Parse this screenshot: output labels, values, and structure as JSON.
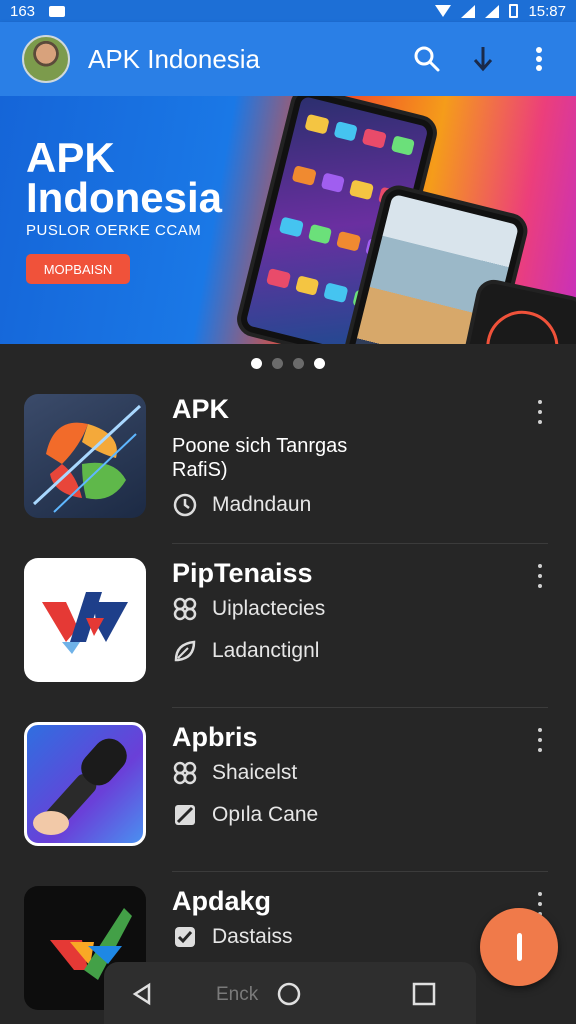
{
  "status_bar": {
    "left_text": "163",
    "time": "15:87"
  },
  "app_bar": {
    "title": "APK Indonesia",
    "icons": [
      "avatar",
      "search-icon",
      "download-icon",
      "more-vert-icon"
    ]
  },
  "banner": {
    "title_line1": "APK",
    "title_line2": "Indonesia",
    "subtitle": "PUSLOR OERKE CCAM",
    "button_label": "MOPBAISN",
    "carousel": {
      "page_count": 4,
      "active_index": 3
    }
  },
  "apps": [
    {
      "name": "APK",
      "description": "Poone sich Tanrgas\nRafiS)",
      "meta": [
        {
          "icon": "clock-icon",
          "text": "Madndaun"
        }
      ],
      "icon": "colorful-swirl-app-icon"
    },
    {
      "name": "PipTenaiss",
      "meta": [
        {
          "icon": "link-icon",
          "text": "Uiplactecies"
        },
        {
          "icon": "leaf-icon",
          "text": "Ladanctignl"
        }
      ],
      "icon": "red-blue-chevron-app-icon"
    },
    {
      "name": "Apbris",
      "meta": [
        {
          "icon": "link-icon",
          "text": "Shaicelst"
        },
        {
          "icon": "tag-icon",
          "text": "Opıla Cane"
        }
      ],
      "icon": "microphone-app-icon"
    },
    {
      "name": "Apdakg",
      "meta": [
        {
          "icon": "check-icon",
          "text": "Dastaiss"
        }
      ],
      "icon": "multicolor-check-app-icon"
    }
  ],
  "nav_bar": {
    "label": "Enck"
  },
  "colors": {
    "app_bar": "#2a7fe6",
    "background": "#262626",
    "fab": "#f07a4a"
  }
}
